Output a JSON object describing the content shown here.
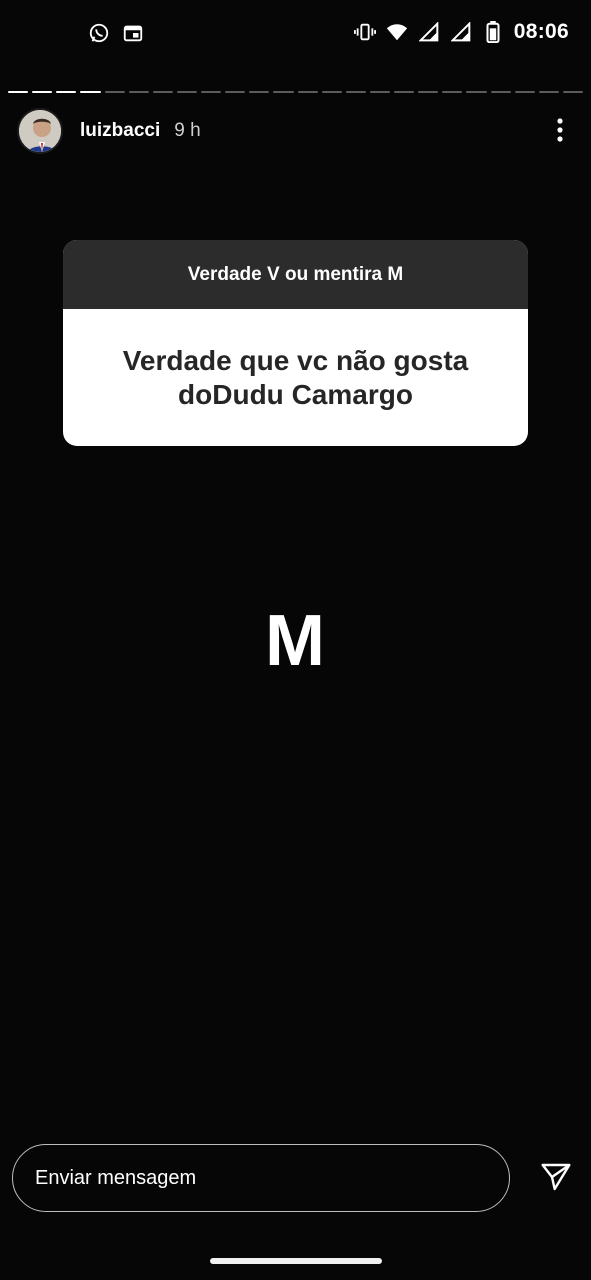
{
  "status_bar": {
    "time": "08:06",
    "left_icons": [
      "whatsapp-icon",
      "calendar-icon"
    ],
    "right_icons": [
      "vibrate-icon",
      "wifi-icon",
      "signal-icon",
      "signal-icon",
      "battery-icon"
    ]
  },
  "story": {
    "progress_segments_total": 24,
    "progress_segments_done": 4
  },
  "header": {
    "username": "luizbacci",
    "time_ago": "9 h"
  },
  "sticker": {
    "title": "Verdade V ou mentira M",
    "question": "Verdade que vc não gosta doDudu Camargo",
    "header_color": "#2c2c2c"
  },
  "answer": "M",
  "message": {
    "placeholder": "Enviar mensagem"
  }
}
